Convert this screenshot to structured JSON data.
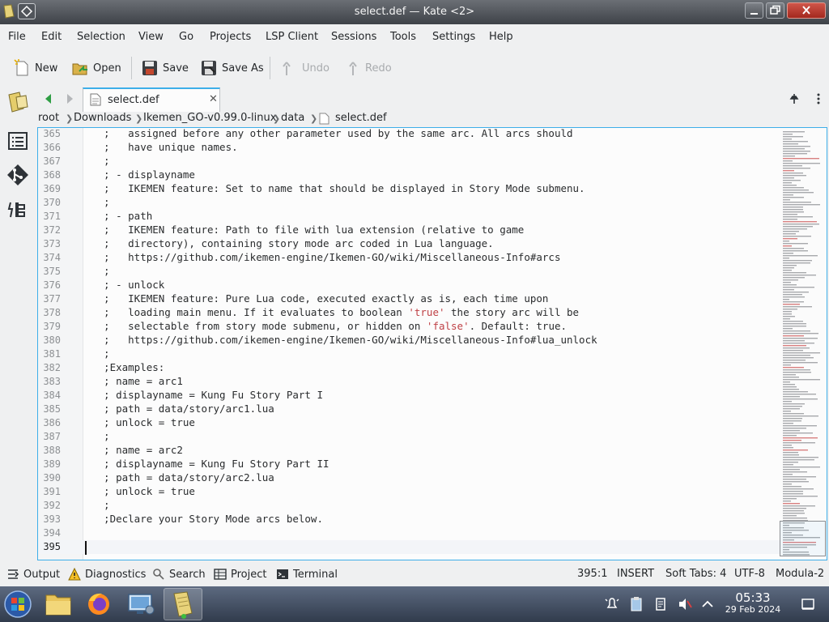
{
  "window": {
    "title": "select.def — Kate <2>"
  },
  "menu": [
    "File",
    "Edit",
    "Selection",
    "View",
    "Go",
    "Projects",
    "LSP Client",
    "Sessions",
    "Tools",
    "Settings",
    "Help"
  ],
  "toolbar": {
    "new_label": "New",
    "open_label": "Open",
    "save_label": "Save",
    "save_as_label": "Save As",
    "undo_label": "Undo",
    "redo_label": "Redo"
  },
  "tab": {
    "label": "select.def",
    "close": "✕"
  },
  "breadcrumb": [
    "root",
    "Downloads",
    "Ikemen_GO-v0.99.0-linux",
    "data",
    "select.def"
  ],
  "editor": {
    "lines": [
      {
        "num": "365",
        "text": "  ;   assigned before any other parameter used by the same arc. All arcs should"
      },
      {
        "num": "366",
        "text": "  ;   have unique names."
      },
      {
        "num": "367",
        "text": "  ;"
      },
      {
        "num": "368",
        "text": "  ; - displayname"
      },
      {
        "num": "369",
        "text": "  ;   IKEMEN feature: Set to name that should be displayed in Story Mode submenu."
      },
      {
        "num": "370",
        "text": "  ;"
      },
      {
        "num": "371",
        "text": "  ; - path"
      },
      {
        "num": "372",
        "text": "  ;   IKEMEN feature: Path to file with lua extension (relative to game"
      },
      {
        "num": "373",
        "text": "  ;   directory), containing story mode arc coded in Lua language."
      },
      {
        "num": "374",
        "text": "  ;   https://github.com/ikemen-engine/Ikemen-GO/wiki/Miscellaneous-Info#arcs"
      },
      {
        "num": "375",
        "text": "  ;"
      },
      {
        "num": "376",
        "text": "  ; - unlock"
      },
      {
        "num": "377",
        "text": "  ;   IKEMEN feature: Pure Lua code, executed exactly as is, each time upon"
      },
      {
        "num": "378a",
        "text": ""
      },
      {
        "num": "379a",
        "text": ""
      },
      {
        "num": "380",
        "text": "  ;   https://github.com/ikemen-engine/Ikemen-GO/wiki/Miscellaneous-Info#lua_unlock"
      },
      {
        "num": "381",
        "text": "  ;"
      },
      {
        "num": "382",
        "text": "  ;Examples:"
      },
      {
        "num": "383",
        "text": "  ; name = arc1"
      },
      {
        "num": "384",
        "text": "  ; displayname = Kung Fu Story Part I"
      },
      {
        "num": "385",
        "text": "  ; path = data/story/arc1.lua"
      },
      {
        "num": "386",
        "text": "  ; unlock = true"
      },
      {
        "num": "387",
        "text": "  ;"
      },
      {
        "num": "388",
        "text": "  ; name = arc2"
      },
      {
        "num": "389",
        "text": "  ; displayname = Kung Fu Story Part II"
      },
      {
        "num": "390",
        "text": "  ; path = data/story/arc2.lua"
      },
      {
        "num": "391",
        "text": "  ; unlock = true"
      },
      {
        "num": "392",
        "text": "  ;"
      },
      {
        "num": "393",
        "text": "  ;Declare your Story Mode arcs below."
      },
      {
        "num": "394",
        "text": ""
      },
      {
        "num": "395",
        "text": ""
      }
    ],
    "line378": {
      "num": "378",
      "pre": "  ;   loading main menu. If it evaluates to boolean ",
      "str": "'true'",
      "post": " the story arc will be"
    },
    "line379": {
      "num": "379",
      "pre": "  ;   selectable from story mode submenu, or hidden on ",
      "str": "'false'",
      "post": ". Default: true."
    },
    "string_color": "#bf4045",
    "accent_color": "#3daee9"
  },
  "statusbar": {
    "output": "Output",
    "diagnostics": "Diagnostics",
    "search": "Search",
    "project": "Project",
    "terminal": "Terminal",
    "position": "395:1",
    "mode": "INSERT",
    "indent": "Soft Tabs: 4",
    "encoding": "UTF-8",
    "syntax": "Modula-2"
  },
  "taskbar": {
    "time": "05:33",
    "date": "29 Feb 2024"
  }
}
